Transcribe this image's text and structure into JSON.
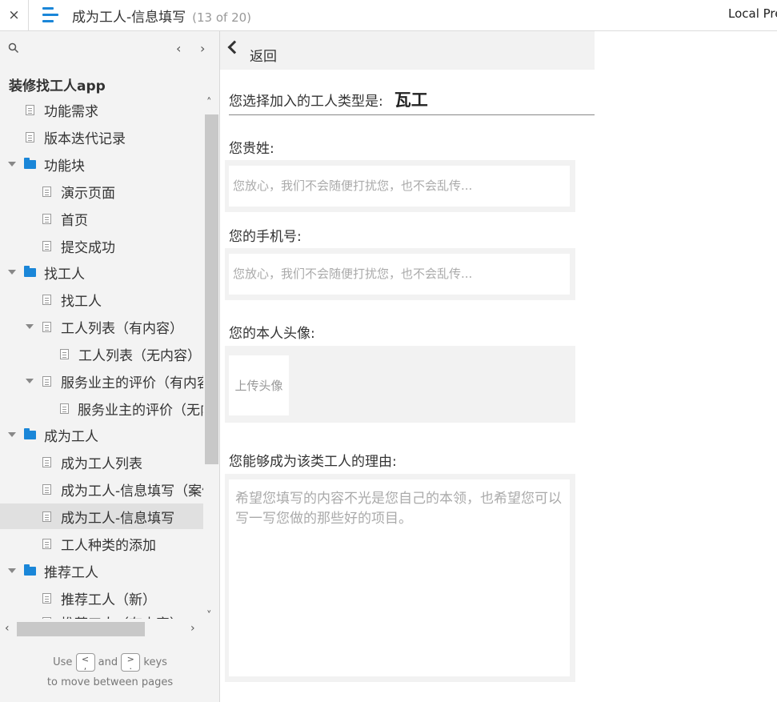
{
  "topbar": {
    "close_icon": "×",
    "title": "成为工人-信息填写",
    "page_count": "(13 of 20)",
    "local_preview": "Local Pre"
  },
  "sidebar": {
    "project_title": "装修找工人app",
    "items": [
      {
        "label": "功能需求",
        "type": "doc"
      },
      {
        "label": "版本迭代记录",
        "type": "doc"
      },
      {
        "label": "功能块",
        "type": "folder",
        "expanded": true
      },
      {
        "label": "演示页面",
        "type": "doc"
      },
      {
        "label": "首页",
        "type": "doc"
      },
      {
        "label": "提交成功",
        "type": "doc"
      },
      {
        "label": "找工人",
        "type": "folder",
        "expanded": true
      },
      {
        "label": "找工人",
        "type": "doc"
      },
      {
        "label": "工人列表（有内容）",
        "type": "doc",
        "expanded": true
      },
      {
        "label": "工人列表（无内容）",
        "type": "doc"
      },
      {
        "label": "服务业主的评价（有内容）",
        "type": "doc",
        "expanded": true
      },
      {
        "label": "服务业主的评价（无内容）",
        "type": "doc"
      },
      {
        "label": "成为工人",
        "type": "folder",
        "expanded": true
      },
      {
        "label": "成为工人列表",
        "type": "doc"
      },
      {
        "label": "成为工人-信息填写（案例）",
        "type": "doc"
      },
      {
        "label": "成为工人-信息填写",
        "type": "doc",
        "selected": true
      },
      {
        "label": "工人种类的添加",
        "type": "doc"
      },
      {
        "label": "推荐工人",
        "type": "folder",
        "expanded": true
      },
      {
        "label": "推荐工人（新）",
        "type": "doc"
      },
      {
        "label": "推荐工人（有内容）",
        "type": "doc"
      }
    ],
    "hint_use": "Use",
    "hint_and": "and",
    "hint_keys": "keys",
    "hint_line2": "to move between pages",
    "key_prev": ",",
    "key_next": "."
  },
  "content": {
    "back_label": "返回",
    "type_label": "您选择加入的工人类型是:",
    "type_value": "瓦工",
    "name_label": "您贵姓:",
    "name_placeholder": "您放心，我们不会随便打扰您，也不会乱传...",
    "phone_label": "您的手机号:",
    "phone_placeholder": "您放心，我们不会随便打扰您，也不会乱传...",
    "avatar_label": "您的本人头像:",
    "avatar_upload": "上传头像",
    "reason_label": "您能够成为该类工人的理由:",
    "reason_placeholder": "希望您填写的内容不光是您自己的本领，也希望您可以写一写您做的那些好的项目。"
  },
  "colors": {
    "accent": "#1a86d8",
    "sidebar_bg": "#f3f3f3",
    "field_bg": "#f2f2f2",
    "selected_bg": "#e0e0e0"
  }
}
